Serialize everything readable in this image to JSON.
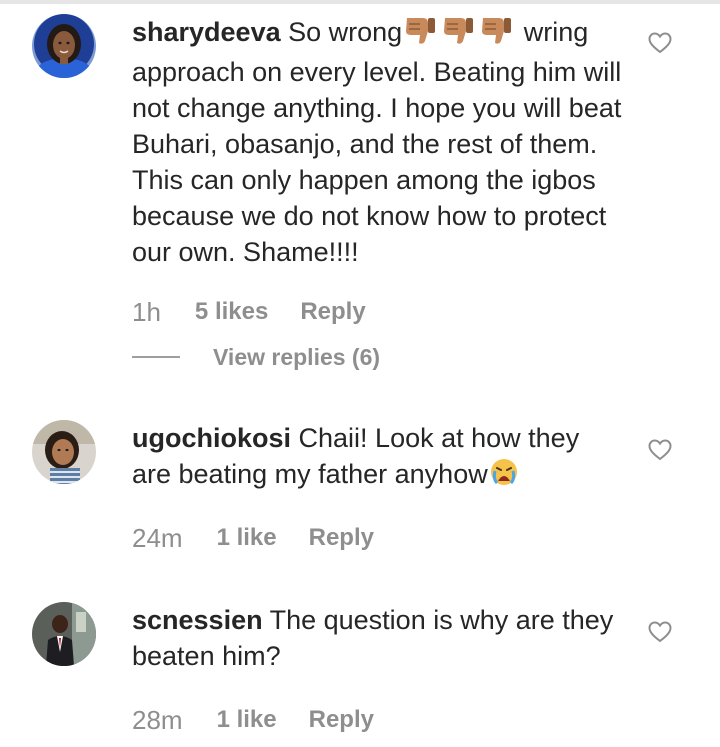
{
  "comments": [
    {
      "username": "sharydeeva",
      "text_before_emoji": "So wrong",
      "emoji": [
        "thumbs-down",
        "thumbs-down",
        "thumbs-down"
      ],
      "text_after_emoji": " wring approach on every level. Beating him will not change anything. I hope you will beat Buhari, obasanjo, and the rest of them. This can only happen among the igbos because we do not know how to protect our own. Shame!!!!",
      "time": "1h",
      "likes": "5 likes",
      "reply_label": "Reply",
      "view_replies": "View replies (6)"
    },
    {
      "username": "ugochiokosi",
      "text_before_emoji": "Chaii! Look at how they are beating my father anyhow",
      "emoji": [
        "crying-face"
      ],
      "text_after_emoji": "",
      "time": "24m",
      "likes": "1 like",
      "reply_label": "Reply"
    },
    {
      "username": "scnessien",
      "text_before_emoji": "The question is why are they beaten him?",
      "emoji": [],
      "text_after_emoji": "",
      "time": "28m",
      "likes": "1 like",
      "reply_label": "Reply"
    }
  ],
  "icons": {
    "like": "heart-outline-icon"
  },
  "colors": {
    "text": "#262626",
    "secondary": "#8e8e8e",
    "heart_outline": "#8e8e8e"
  }
}
